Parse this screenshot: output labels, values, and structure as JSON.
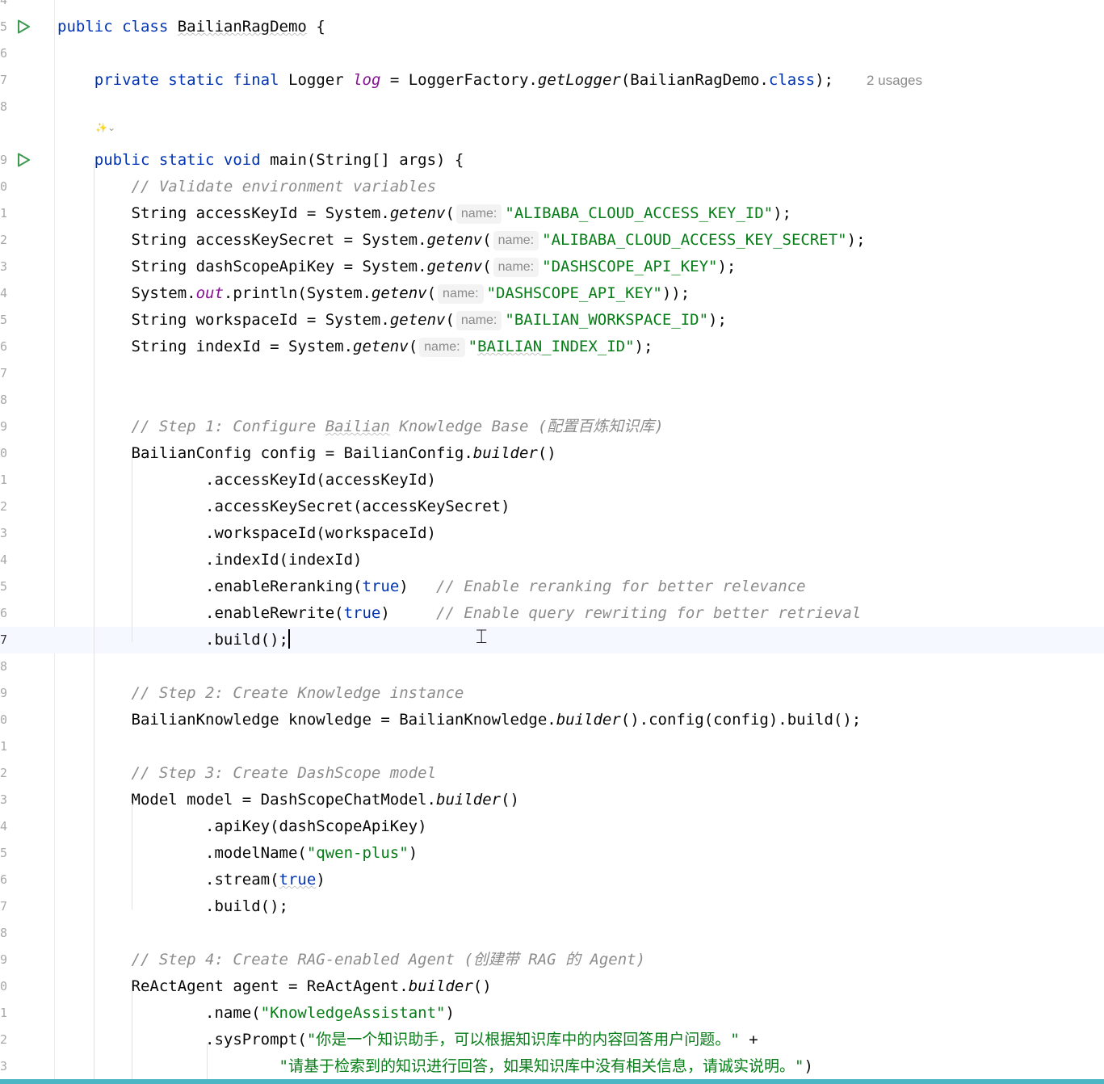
{
  "editor": {
    "code_lines": [
      {
        "num": "4",
        "segments": []
      },
      {
        "num": "5",
        "run": true,
        "segments": [
          {
            "t": "public ",
            "c": "kw"
          },
          {
            "t": "class ",
            "c": "kw"
          },
          {
            "t": "BailianRagDemo",
            "c": "wavy"
          },
          {
            "t": " {"
          }
        ]
      },
      {
        "num": "6",
        "segments": []
      },
      {
        "num": "7",
        "segments": [
          {
            "t": "    "
          },
          {
            "t": "private ",
            "c": "kw"
          },
          {
            "t": "static ",
            "c": "kw"
          },
          {
            "t": "final ",
            "c": "kw"
          },
          {
            "t": "Logger "
          },
          {
            "t": "log",
            "c": "fld"
          },
          {
            "t": " = LoggerFactory."
          },
          {
            "t": "getLogger",
            "c": "it"
          },
          {
            "t": "(BailianRagDemo."
          },
          {
            "t": "class",
            "c": "kw"
          },
          {
            "t": ");"
          }
        ]
      },
      {
        "num": "8",
        "segments": []
      },
      {
        "num": "",
        "segments": []
      },
      {
        "num": "9",
        "run": true,
        "segments": [
          {
            "t": "    "
          },
          {
            "t": "public ",
            "c": "kw"
          },
          {
            "t": "static ",
            "c": "kw"
          },
          {
            "t": "void ",
            "c": "kw"
          },
          {
            "t": "main(String[] args) {"
          }
        ]
      },
      {
        "num": "0",
        "segments": [
          {
            "t": "        "
          },
          {
            "t": "// Validate environment variables",
            "c": "cm"
          }
        ]
      },
      {
        "num": "1",
        "segments": [
          {
            "t": "        String accessKeyId = System."
          },
          {
            "t": "getenv",
            "c": "it"
          },
          {
            "t": "("
          },
          {
            "hint": "name:"
          },
          {
            "t": "\"ALIBABA_CLOUD_ACCESS_KEY_ID\"",
            "c": "str"
          },
          {
            "t": ");"
          }
        ]
      },
      {
        "num": "2",
        "segments": [
          {
            "t": "        String accessKeySecret = System."
          },
          {
            "t": "getenv",
            "c": "it"
          },
          {
            "t": "("
          },
          {
            "hint": "name:"
          },
          {
            "t": "\"ALIBABA_CLOUD_ACCESS_KEY_SECRET\"",
            "c": "str"
          },
          {
            "t": ");"
          }
        ]
      },
      {
        "num": "3",
        "segments": [
          {
            "t": "        String dashScopeApiKey = System."
          },
          {
            "t": "getenv",
            "c": "it"
          },
          {
            "t": "("
          },
          {
            "hint": "name:"
          },
          {
            "t": "\"DASHSCOPE_API_KEY\"",
            "c": "str"
          },
          {
            "t": ");"
          }
        ]
      },
      {
        "num": "4",
        "segments": [
          {
            "t": "        System."
          },
          {
            "t": "out",
            "c": "fld"
          },
          {
            "t": ".println(System."
          },
          {
            "t": "getenv",
            "c": "it"
          },
          {
            "t": "("
          },
          {
            "hint": "name:"
          },
          {
            "t": "\"DASHSCOPE_API_KEY\"",
            "c": "str"
          },
          {
            "t": "));"
          }
        ]
      },
      {
        "num": "5",
        "segments": [
          {
            "t": "        String workspaceId = System."
          },
          {
            "t": "getenv",
            "c": "it"
          },
          {
            "t": "("
          },
          {
            "hint": "name:"
          },
          {
            "t": "\"BAILIAN_WORKSPACE_ID\"",
            "c": "str"
          },
          {
            "t": ");"
          }
        ]
      },
      {
        "num": "6",
        "segments": [
          {
            "t": "        String indexId = System."
          },
          {
            "t": "getenv",
            "c": "it"
          },
          {
            "t": "("
          },
          {
            "hint": "name:"
          },
          {
            "t": "\"",
            "c": "str"
          },
          {
            "t": "BAILIAN",
            "c": "str wavy"
          },
          {
            "t": "_INDEX_ID\"",
            "c": "str"
          },
          {
            "t": ");"
          }
        ]
      },
      {
        "num": "7",
        "segments": []
      },
      {
        "num": "8",
        "segments": []
      },
      {
        "num": "9",
        "segments": [
          {
            "t": "        "
          },
          {
            "t": "// Step 1: Configure ",
            "c": "cm"
          },
          {
            "t": "Bailian",
            "c": "cm wavy"
          },
          {
            "t": " Knowledge Base (配置百炼知识库)",
            "c": "cm"
          }
        ]
      },
      {
        "num": "0",
        "segments": [
          {
            "t": "        BailianConfig config = BailianConfig."
          },
          {
            "t": "builder",
            "c": "it"
          },
          {
            "t": "()"
          }
        ]
      },
      {
        "num": "1",
        "segments": [
          {
            "t": "                .accessKeyId(accessKeyId)"
          }
        ]
      },
      {
        "num": "2",
        "segments": [
          {
            "t": "                .accessKeySecret(accessKeySecret)"
          }
        ]
      },
      {
        "num": "3",
        "segments": [
          {
            "t": "                .workspaceId(workspaceId)"
          }
        ]
      },
      {
        "num": "4",
        "segments": [
          {
            "t": "                .indexId(indexId)"
          }
        ]
      },
      {
        "num": "5",
        "segments": [
          {
            "t": "                .enableReranking("
          },
          {
            "t": "true",
            "c": "kw"
          },
          {
            "t": ")   "
          },
          {
            "t": "// Enable reranking for better relevance",
            "c": "cm"
          }
        ]
      },
      {
        "num": "6",
        "segments": [
          {
            "t": "                .enableRewrite("
          },
          {
            "t": "true",
            "c": "kw"
          },
          {
            "t": ")     "
          },
          {
            "t": "// Enable query rewriting for better retrieval",
            "c": "cm"
          }
        ]
      },
      {
        "num": "7",
        "current": true,
        "caret": true,
        "segments": [
          {
            "t": "                .build();"
          }
        ]
      },
      {
        "num": "8",
        "segments": []
      },
      {
        "num": "9",
        "segments": [
          {
            "t": "        "
          },
          {
            "t": "// Step 2: Create Knowledge instance",
            "c": "cm"
          }
        ]
      },
      {
        "num": "0",
        "segments": [
          {
            "t": "        BailianKnowledge knowledge = BailianKnowledge."
          },
          {
            "t": "builder",
            "c": "it"
          },
          {
            "t": "().config(config).build();"
          }
        ]
      },
      {
        "num": "1",
        "segments": []
      },
      {
        "num": "2",
        "segments": [
          {
            "t": "        "
          },
          {
            "t": "// Step 3: Create DashScope model",
            "c": "cm"
          }
        ]
      },
      {
        "num": "3",
        "segments": [
          {
            "t": "        Model model = DashScopeChatModel."
          },
          {
            "t": "builder",
            "c": "it"
          },
          {
            "t": "()"
          }
        ]
      },
      {
        "num": "4",
        "segments": [
          {
            "t": "                .apiKey(dashScopeApiKey)"
          }
        ]
      },
      {
        "num": "5",
        "segments": [
          {
            "t": "                .modelName("
          },
          {
            "t": "\"qwen-plus\"",
            "c": "str"
          },
          {
            "t": ")"
          }
        ]
      },
      {
        "num": "6",
        "segments": [
          {
            "t": "                .stream("
          },
          {
            "t": "true",
            "c": "kw wavy"
          },
          {
            "t": ")"
          }
        ]
      },
      {
        "num": "7",
        "segments": [
          {
            "t": "                .build();"
          }
        ]
      },
      {
        "num": "8",
        "segments": []
      },
      {
        "num": "9",
        "segments": [
          {
            "t": "        "
          },
          {
            "t": "// Step 4: Create RAG-enabled Agent (创建带 RAG 的 Agent)",
            "c": "cm"
          }
        ]
      },
      {
        "num": "0",
        "segments": [
          {
            "t": "        ReActAgent agent = ReActAgent."
          },
          {
            "t": "builder",
            "c": "it"
          },
          {
            "t": "()"
          }
        ]
      },
      {
        "num": "1",
        "segments": [
          {
            "t": "                .name("
          },
          {
            "t": "\"KnowledgeAssistant\"",
            "c": "str"
          },
          {
            "t": ")"
          }
        ]
      },
      {
        "num": "2",
        "segments": [
          {
            "t": "                .sysPrompt("
          },
          {
            "t": "\"你是一个知识助手，可以根据知识库中的内容回答用户问题。\"",
            "c": "str"
          },
          {
            "t": " +"
          }
        ]
      },
      {
        "num": "3",
        "segments": [
          {
            "t": "                        "
          },
          {
            "t": "\"请基于检索到的知识进行回答，如果知识库中没有相关信息，请诚实说明。\"",
            "c": "str"
          },
          {
            "t": ")"
          }
        ]
      }
    ],
    "usages_label": "2 usages",
    "inline_tool_label": "✨⌄",
    "icons": {
      "run": "run-gutter-icon",
      "cursor": "text-cursor-icon"
    },
    "colors": {
      "keyword": "#0033b3",
      "string": "#067d17",
      "comment": "#8c8c8c",
      "field": "#871094",
      "current_line": "#f5f8fe",
      "bottom_bar": "#4db6c4"
    }
  }
}
